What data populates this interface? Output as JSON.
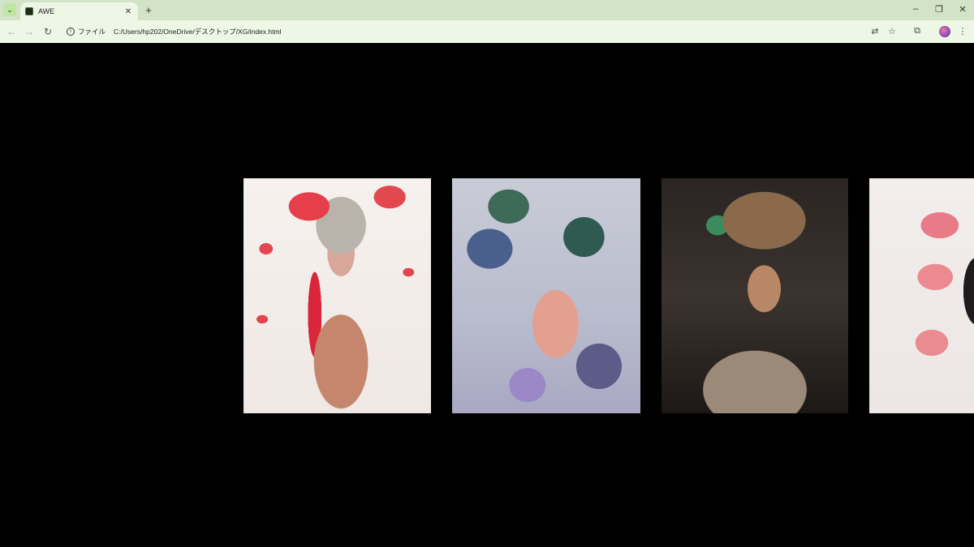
{
  "browser": {
    "tab": {
      "title": "AWE",
      "close_glyph": "✕"
    },
    "new_tab_glyph": "+",
    "tab_search_glyph": "⌄",
    "window_controls": {
      "minimize": "–",
      "restore": "❐",
      "close": "✕"
    },
    "nav": {
      "back": "←",
      "forward": "→",
      "reload": "↻"
    },
    "address": {
      "scheme_label": "ファイル",
      "url": "C:/Users/hp202/OneDrive/デスクトップ/XG/index.html"
    },
    "toolbar_icons": {
      "translate": "⇄",
      "bookmark": "☆",
      "extensions": "⧉",
      "menu": "⋮"
    }
  },
  "gallery": {
    "items": [
      {
        "alt_icon": "portrait-red-petals"
      },
      {
        "alt_icon": "portrait-floral-blue"
      },
      {
        "alt_icon": "portrait-gold-headdress"
      },
      {
        "alt_icon": "portrait-pink-lilies"
      }
    ]
  }
}
